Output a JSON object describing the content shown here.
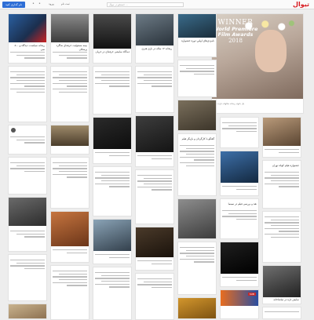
{
  "header": {
    "logo": "تیوال",
    "search_placeholder": "جستجو در تیوال ...",
    "nav": [
      "تیوال",
      "ورود",
      "ثبت نام"
    ],
    "button": "نام گذاری کنید"
  },
  "feature": {
    "award_line1": "WINNER",
    "award_line2": "World Premiere",
    "award_line3": "Film Awards",
    "award_year": "2018",
    "caption": "یک بانوی ریحانه سالهای بازی من"
  },
  "cards": [
    {
      "text": "ریحانه سیاست، دیدگاه و ۵۰۰ سی"
    },
    {
      "text": "بیمه مسئولیت حرفه‌ای شاگرد پزشکان"
    },
    {
      "text": "دیدگاه نمایشی حرفه‌ای در جریان"
    },
    {
      "text": "ریحانه ۱۲ ساله در بازی هنری"
    },
    {
      "text": "نامزدی‌های اولین دوره جشنواره"
    },
    {
      "text": "گفتگو با کارگردان و بازیگر فیلم"
    },
    {
      "text": "نقد و بررسی فیلم در سینما"
    },
    {
      "text": "جشنواره فیلم کوتاه تهران"
    },
    {
      "text": "نمایش تازه در تماشاخانه"
    }
  ],
  "badges": {
    "red": "SUB"
  },
  "colors": {
    "brand": "#d7191f",
    "accent": "#2f6fd6"
  }
}
